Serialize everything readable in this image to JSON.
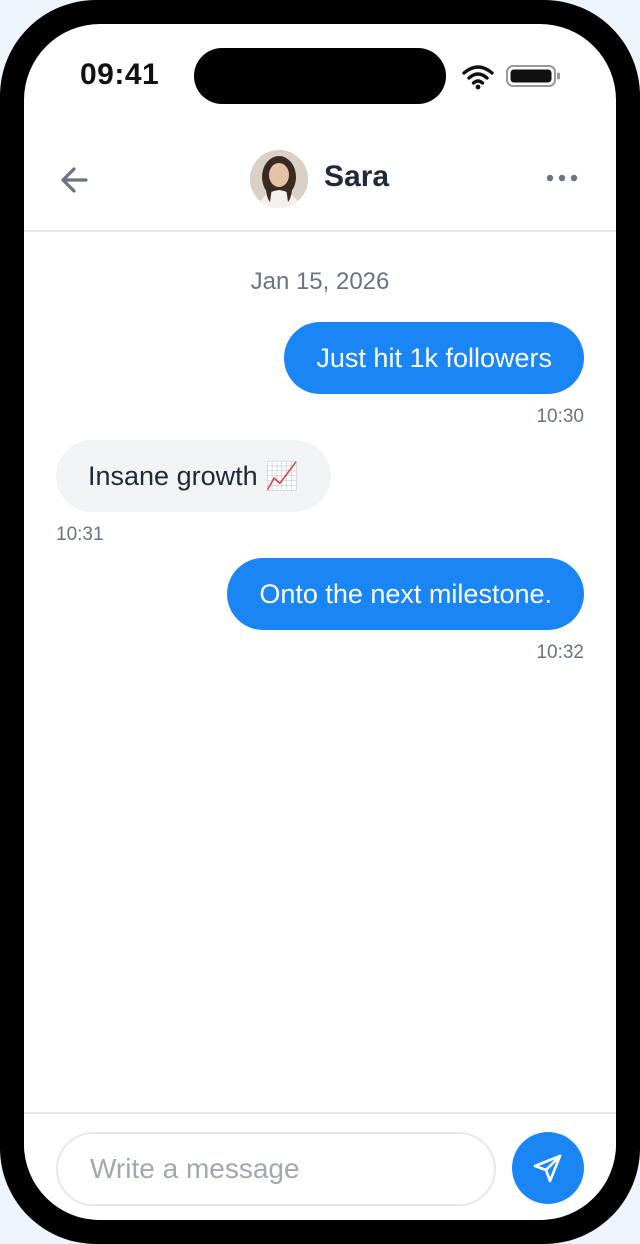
{
  "status_bar": {
    "time": "09:41",
    "icons": [
      "wifi-icon",
      "battery-icon"
    ]
  },
  "header": {
    "contact_name": "Sara",
    "icons": [
      "back-arrow-icon",
      "more-options-icon"
    ]
  },
  "conversation": {
    "date": "Jan 15, 2026",
    "messages": [
      {
        "direction": "outgoing",
        "text": "Just hit 1k followers",
        "time": "10:30"
      },
      {
        "direction": "incoming",
        "text": "Insane growth 📈",
        "time": "10:31"
      },
      {
        "direction": "outgoing",
        "text": "Onto the next milestone.",
        "time": "10:32"
      }
    ]
  },
  "composer": {
    "placeholder": "Write a message",
    "value": "",
    "send_icon": "send-icon"
  },
  "colors": {
    "accent": "#1a86f5",
    "incoming_bubble": "#f2f3f5",
    "frame": "#000000"
  }
}
